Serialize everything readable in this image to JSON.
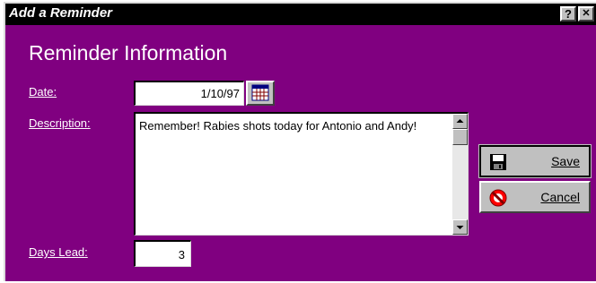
{
  "window": {
    "title": "Add a Reminder",
    "help_label": "?",
    "close_label": "✕"
  },
  "heading": "Reminder Information",
  "form": {
    "date_label": "Date:",
    "date_value": "1/10/97",
    "description_label": "Description:",
    "description_value": "Remember!  Rabies shots today for Antonio and Andy!",
    "days_lead_label": "Days Lead:",
    "days_lead_value": "3"
  },
  "buttons": {
    "save_label": "Save",
    "cancel_label": "Cancel"
  },
  "icons": {
    "calendar": "calendar-icon",
    "save": "floppy-disk-icon",
    "cancel": "no-entry-icon"
  },
  "colors": {
    "background": "#800080",
    "titlebar": "#000000"
  }
}
